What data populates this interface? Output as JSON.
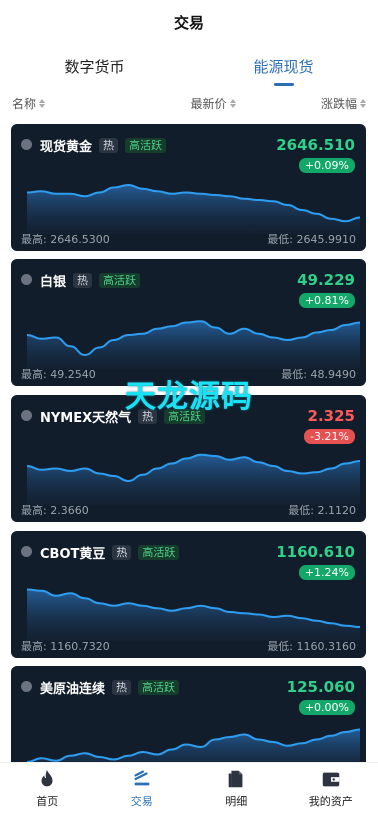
{
  "header": {
    "title": "交易"
  },
  "tabs": [
    {
      "label": "数字货币",
      "active": false
    },
    {
      "label": "能源现货",
      "active": true
    }
  ],
  "columns": {
    "name": "名称",
    "price": "最新价",
    "change": "涨跌幅"
  },
  "cards": [
    {
      "name": "现货黄金",
      "hot": "热",
      "tag": "高活跃",
      "price": "2646.510",
      "change": "+0.09%",
      "trend": "up",
      "high": "最高: 2646.5300",
      "low": "最低: 2645.9910",
      "series": [
        30,
        31,
        29,
        29,
        27,
        30,
        34,
        36,
        33,
        31,
        29,
        30,
        29,
        28,
        27,
        25,
        24,
        23,
        20,
        16,
        13,
        9,
        7,
        10
      ]
    },
    {
      "name": "白银",
      "hot": "热",
      "tag": "高活跃",
      "price": "49.229",
      "change": "+0.81%",
      "trend": "up",
      "high": "最高: 49.2540",
      "low": "最低: 48.9490",
      "series": [
        24,
        21,
        22,
        15,
        8,
        14,
        20,
        24,
        25,
        29,
        31,
        34,
        35,
        30,
        25,
        29,
        25,
        22,
        20,
        22,
        26,
        28,
        32,
        34
      ]
    },
    {
      "name": "NYMEX天然气",
      "hot": "热",
      "tag": "高活跃",
      "price": "2.325",
      "change": "-3.21%",
      "trend": "down",
      "high": "最高: 2.3660",
      "low": "最低: 2.1120",
      "series": [
        28,
        25,
        26,
        24,
        26,
        22,
        20,
        16,
        21,
        26,
        30,
        34,
        37,
        36,
        33,
        35,
        31,
        28,
        24,
        22,
        23,
        26,
        30,
        32
      ]
    },
    {
      "name": "CBOT黄豆",
      "hot": "热",
      "tag": "高活跃",
      "price": "1160.610",
      "change": "+1.24%",
      "trend": "up",
      "high": "最高: 1160.7320",
      "low": "最低: 1160.3160",
      "series": [
        38,
        37,
        33,
        35,
        31,
        27,
        25,
        27,
        25,
        23,
        21,
        23,
        25,
        23,
        20,
        19,
        18,
        16,
        17,
        15,
        13,
        11,
        9,
        8
      ]
    },
    {
      "name": "美原油连续",
      "hot": "热",
      "tag": "高活跃",
      "price": "125.060",
      "change": "+0.00%",
      "trend": "up",
      "high": "",
      "low": "",
      "series": [
        8,
        11,
        9,
        13,
        15,
        12,
        10,
        13,
        16,
        14,
        18,
        22,
        20,
        26,
        28,
        30,
        26,
        24,
        21,
        23,
        26,
        29,
        32,
        34
      ]
    }
  ],
  "watermark": "天龙源码",
  "tabbar": [
    {
      "label": "首页",
      "icon": "flame-icon",
      "active": false
    },
    {
      "label": "交易",
      "icon": "trade-icon",
      "active": true
    },
    {
      "label": "明细",
      "icon": "document-icon",
      "active": false
    },
    {
      "label": "我的资产",
      "icon": "wallet-icon",
      "active": false
    }
  ],
  "colors": {
    "accent": "#2b6fb6",
    "card_bg": "#121d2b",
    "up": "#2fd08a",
    "down": "#ff5a5a",
    "line": "#2e9df0"
  }
}
